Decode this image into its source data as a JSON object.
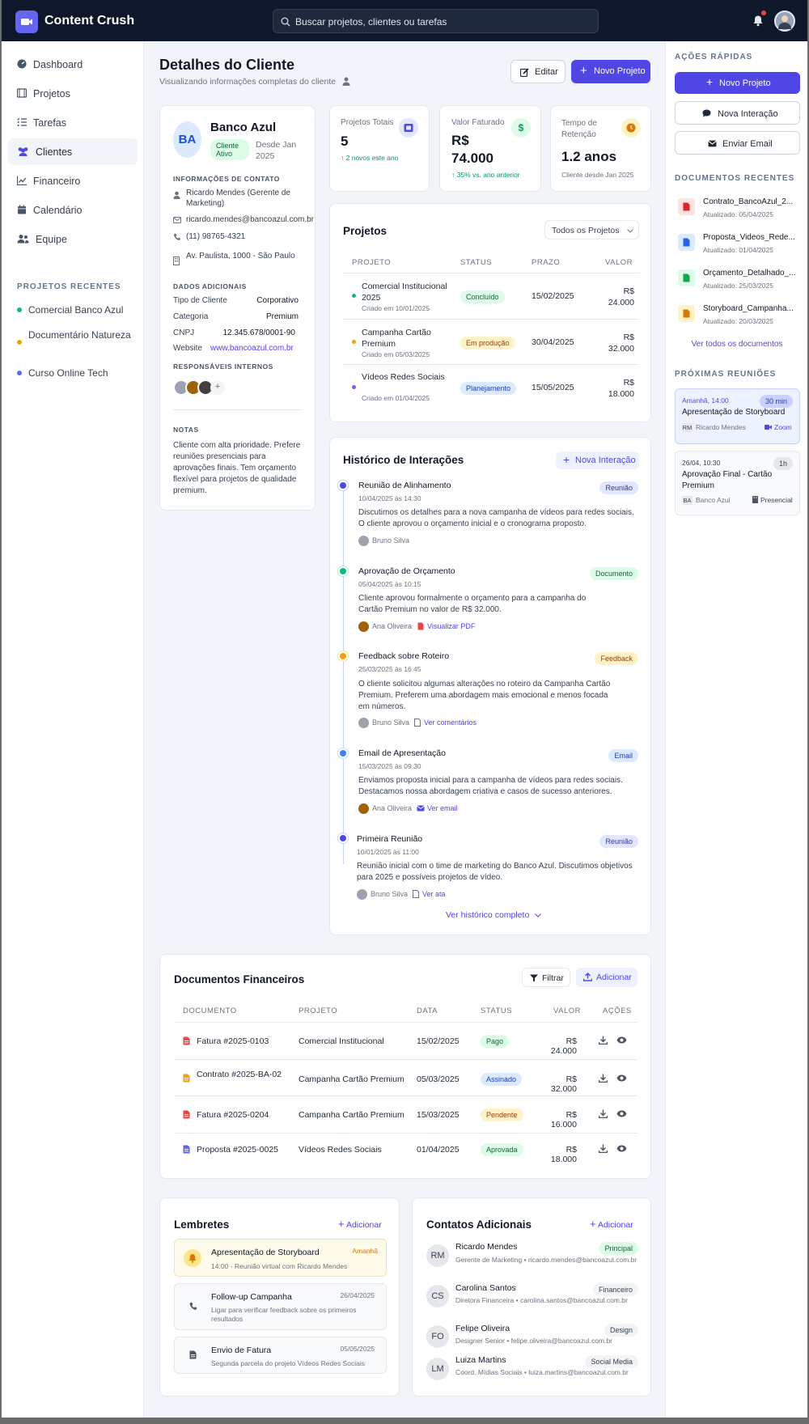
{
  "app": {
    "name": "Content Crush",
    "search_placeholder": "Buscar projetos, clientes ou tarefas"
  },
  "nav": {
    "items": [
      "Dashboard",
      "Projetos",
      "Tarefas",
      "Clientes",
      "Financeiro",
      "Calendário",
      "Equipe"
    ],
    "recent_title": "PROJETOS RECENTES",
    "recent": [
      "Comercial Banco Azul",
      "Documentário Natureza",
      "Curso Online Tech"
    ]
  },
  "header": {
    "title": "Detalhes do Cliente",
    "subtitle": "Visualizando informações completas do cliente",
    "edit": "Editar",
    "new_project": "Novo Projeto"
  },
  "client": {
    "initials": "BA",
    "name": "Banco Azul",
    "status": "Cliente Ativo",
    "since": "Desde Jan 2025",
    "contact_title": "INFORMAÇÕES DE CONTATO",
    "contact_name": "Ricardo Mendes (Gerente de Marketing)",
    "email": "ricardo.mendes@bancoazul.com.br",
    "phone": "(11) 98765-4321",
    "address": "Av. Paulista, 1000 - São Paulo",
    "extra_title": "DADOS ADICIONAIS",
    "extra": [
      {
        "k": "Tipo de Cliente",
        "v": "Corporativo"
      },
      {
        "k": "Categoria",
        "v": "Premium"
      },
      {
        "k": "CNPJ",
        "v": "12.345.678/0001-90"
      },
      {
        "k": "Website",
        "v": "www.bancoazul.com.br"
      }
    ],
    "responsaveis_title": "RESPONSÁVEIS INTERNOS",
    "add": "+",
    "notes_title": "NOTAS",
    "notes": "Cliente com alta prioridade. Prefere reuniões presenciais para aprovações finais. Tem orçamento flexível para projetos de qualidade premium."
  },
  "stats": [
    {
      "label": "Projetos Totais",
      "value": "5",
      "delta": "2 novos este ano"
    },
    {
      "label": "Valor Faturado",
      "value": "R$ 74.000",
      "delta": "35% vs. ano anterior"
    },
    {
      "label": "Tempo de Retenção",
      "value": "1.2 anos",
      "delta": "Cliente desde Jan 2025"
    }
  ],
  "projects": {
    "title": "Projetos",
    "filter": "Todos os Projetos",
    "headers": [
      "PROJETO",
      "STATUS",
      "PRAZO",
      "VALOR"
    ],
    "rows": [
      {
        "name": "Comercial Institucional 2025",
        "created": "Criado em 10/01/2025",
        "status": "Concluído",
        "deadline": "15/02/2025",
        "value": "R$ 24.000",
        "color": "#10b981"
      },
      {
        "name": "Campanha Cartão Premium",
        "created": "Criado em 05/03/2025",
        "status": "Em produção",
        "deadline": "30/04/2025",
        "value": "R$ 32.000",
        "color": "#f59e0b"
      },
      {
        "name": "Vídeos Redes Sociais",
        "created": "Criado em 01/04/2025",
        "status": "Planejamento",
        "deadline": "15/05/2025",
        "value": "R$ 18.000",
        "color": "#6366f1"
      }
    ]
  },
  "history": {
    "title": "Histórico de Interações",
    "new": "Nova Interação",
    "more": "Ver histórico completo",
    "items": [
      {
        "title": "Reunião de Alinhamento",
        "date": "10/04/2025 às 14:30",
        "tag": "Reunião",
        "text": "Discutimos os detalhes para a nova campanha de vídeos para redes sociais. O cliente aprovou o orçamento inicial e o cronograma proposto.",
        "author": "Bruno Silva",
        "link": ""
      },
      {
        "title": "Aprovação de Orçamento",
        "date": "05/04/2025 às 10:15",
        "tag": "Documento",
        "text": "Cliente aprovou formalmente o orçamento para a campanha do Cartão Premium no valor de R$ 32.000.",
        "author": "Ana Oliveira",
        "link": "Visualizar PDF"
      },
      {
        "title": "Feedback sobre Roteiro",
        "date": "25/03/2025 às 16:45",
        "tag": "Feedback",
        "text": "O cliente solicitou algumas alterações no roteiro da Campanha Cartão Premium. Preferem uma abordagem mais emocional e menos focada em números.",
        "author": "Bruno Silva",
        "link": "Ver comentários"
      },
      {
        "title": "Email de Apresentação",
        "date": "15/03/2025 às 09:30",
        "tag": "Email",
        "text": "Enviamos proposta inicial para a campanha de vídeos para redes sociais. Destacamos nossa abordagem criativa e casos de sucesso anteriores.",
        "author": "Ana Oliveira",
        "link": "Ver email"
      },
      {
        "title": "Primeira Reunião",
        "date": "10/01/2025 às 11:00",
        "tag": "Reunião",
        "text": "Reunião inicial com o time de marketing do Banco Azul. Discutimos objetivos para 2025 e possíveis projetos de vídeo.",
        "author": "Bruno Silva",
        "link": "Ver ata"
      }
    ]
  },
  "finance": {
    "title": "Documentos Financeiros",
    "filter": "Filtrar",
    "add": "Adicionar",
    "headers": [
      "DOCUMENTO",
      "PROJETO",
      "DATA",
      "STATUS",
      "VALOR",
      "AÇÕES"
    ],
    "rows": [
      {
        "doc": "Fatura #2025-0103",
        "project": "Comercial Institucional",
        "date": "15/02/2025",
        "status": "Pago",
        "value": "R$ 24.000"
      },
      {
        "doc": "Contrato #2025-BA-02",
        "project": "Campanha Cartão Premium",
        "date": "05/03/2025",
        "status": "Assinado",
        "value": "R$ 32.000"
      },
      {
        "doc": "Fatura #2025-0204",
        "project": "Campanha Cartão Premium",
        "date": "15/03/2025",
        "status": "Pendente",
        "value": "R$ 16.000"
      },
      {
        "doc": "Proposta #2025-0025",
        "project": "Vídeos Redes Sociais",
        "date": "01/04/2025",
        "status": "Aprovada",
        "value": "R$ 18.000"
      }
    ]
  },
  "reminders": {
    "title": "Lembretes",
    "add": "Adicionar",
    "items": [
      {
        "title": "Apresentação de Storyboard",
        "when": "Amanhã",
        "desc": "14:00 - Reunião virtual com Ricardo Mendes"
      },
      {
        "title": "Follow-up Campanha",
        "when": "26/04/2025",
        "desc": "Ligar para verificar feedback sobre os primeiros resultados"
      },
      {
        "title": "Envio de Fatura",
        "when": "05/05/2025",
        "desc": "Segunda parcela do projeto Vídeos Redes Sociais"
      }
    ]
  },
  "contacts": {
    "title": "Contatos Adicionais",
    "add": "Adicionar",
    "items": [
      {
        "initials": "RM",
        "name": "Ricardo Mendes",
        "tag": "Principal",
        "desc": "Gerente de Marketing • ricardo.mendes@bancoazul.com.br"
      },
      {
        "initials": "CS",
        "name": "Carolina Santos",
        "tag": "Financeiro",
        "desc": "Diretora Financeira • carolina.santos@bancoazul.com.br"
      },
      {
        "initials": "FO",
        "name": "Felipe Oliveira",
        "tag": "Design",
        "desc": "Designer Senior • felipe.oliveira@bancoazul.com.br"
      },
      {
        "initials": "LM",
        "name": "Luiza Martins",
        "tag": "Social Media",
        "desc": "Coord. Mídias Sociais • luiza.martins@bancoazul.com.br"
      }
    ]
  },
  "quick": {
    "title": "AÇÕES RÁPIDAS",
    "new_project": "Novo Projeto",
    "new_interaction": "Nova Interação",
    "send_email": "Enviar Email"
  },
  "docs": {
    "title": "DOCUMENTOS RECENTES",
    "more": "Ver todos os documentos",
    "items": [
      {
        "name": "Contrato_BancoAzul_2...",
        "updated": "Atualizado: 05/04/2025"
      },
      {
        "name": "Proposta_Videos_Rede...",
        "updated": "Atualizado: 01/04/2025"
      },
      {
        "name": "Orçamento_Detalhado_...",
        "updated": "Atualizado: 25/03/2025"
      },
      {
        "name": "Storyboard_Campanha...",
        "updated": "Atualizado: 20/03/2025"
      }
    ]
  },
  "meetings": {
    "title": "PRÓXIMAS REUNIÕES",
    "items": [
      {
        "when": "Amanhã, 14:00",
        "dur": "30 min",
        "title": "Apresentação de Storyboard",
        "initials": "RM",
        "who": "Ricardo Mendes",
        "mode": "Zoom"
      },
      {
        "when": "26/04, 10:30",
        "dur": "1h",
        "title": "Aprovação Final - Cartão Premium",
        "initials": "BA",
        "who": "Banco Azul",
        "mode": "Presencial"
      }
    ]
  },
  "colors": {
    "accent": "#4f46e5",
    "success": "#10b981",
    "warning": "#f59e0b",
    "danger": "#ef4444",
    "nav_bg": "#0f172a"
  }
}
